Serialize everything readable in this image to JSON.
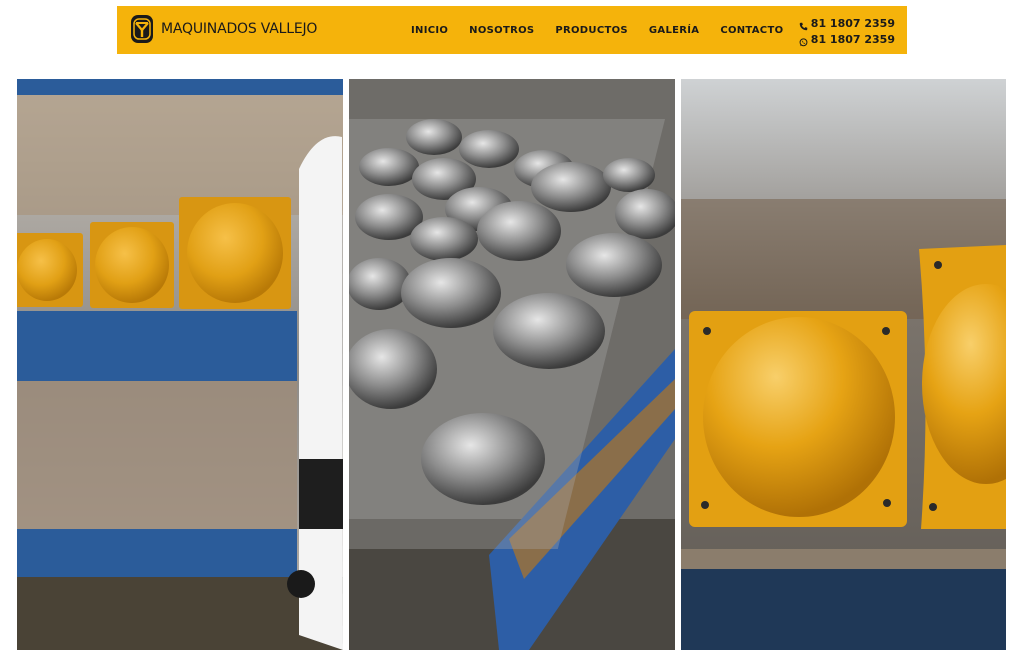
{
  "brand": {
    "name": "MAQUINADOS VALLEJO"
  },
  "nav": {
    "items": [
      "INICIO",
      "NOSOTROS",
      "PRODUCTOS",
      "GALERÍA",
      "CONTACTO"
    ]
  },
  "contact": {
    "phone": "81 1807 2359",
    "whatsapp": "81 1807 2359"
  },
  "colors": {
    "header_bg": "#f5b30b",
    "text": "#1a1a1a",
    "product_yellow": "#e9a314",
    "pallet_blue": "#2b5c9a"
  },
  "gallery": {
    "photos": [
      {
        "name": "yellow-domes-on-wrapped-pallet"
      },
      {
        "name": "galvanized-dome-stack-on-pallet"
      },
      {
        "name": "yellow-dome-closeup"
      }
    ]
  }
}
